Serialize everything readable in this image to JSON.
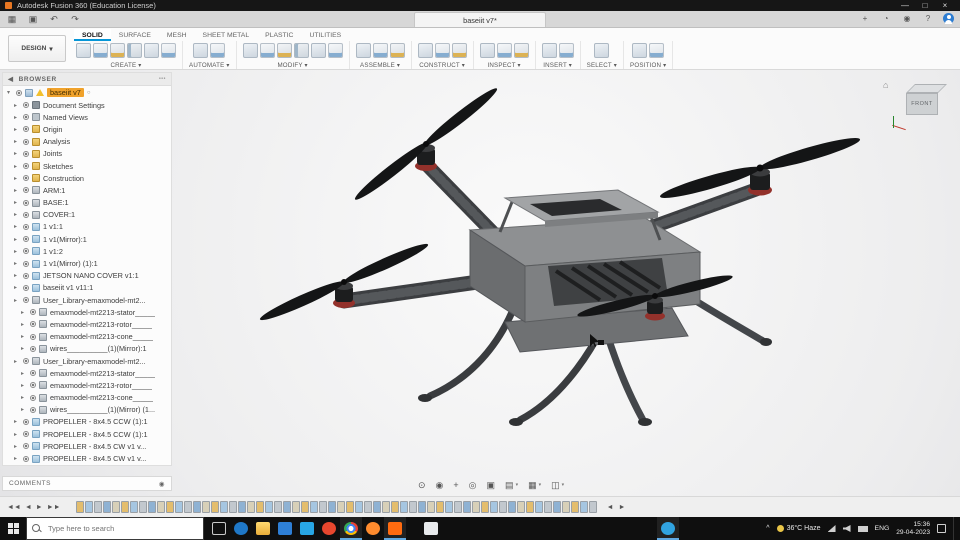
{
  "title_bar": {
    "title": "Autodesk Fusion 360 (Education License)"
  },
  "glyphs": {
    "menu": "▦",
    "save": "▣",
    "undo": "↶",
    "redo": "↷",
    "minimize": "—",
    "maximize": "□",
    "close": "×",
    "extensions": "+",
    "job_status": "◔",
    "notifications": "◉",
    "help": "?",
    "collapse": "◀",
    "options": "•••",
    "expand_item": "▸",
    "root_expand": "▾",
    "design_caret": "▾",
    "tray_expand": "^",
    "home": "⌂",
    "sync": "○",
    "comments_icon": "◉"
  },
  "quick_access": {
    "doc_tab": "baseiit v7*"
  },
  "toolbar": {
    "design_label": "DESIGN",
    "tabs": [
      {
        "label": "SOLID",
        "active": true
      },
      {
        "label": "SURFACE"
      },
      {
        "label": "MESH"
      },
      {
        "label": "SHEET METAL"
      },
      {
        "label": "PLASTIC"
      },
      {
        "label": "UTILITIES"
      }
    ],
    "groups": [
      {
        "label": "CREATE",
        "icons": 6
      },
      {
        "label": "AUTOMATE",
        "icons": 2
      },
      {
        "label": "MODIFY",
        "icons": 6
      },
      {
        "label": "ASSEMBLE",
        "icons": 3
      },
      {
        "label": "CONSTRUCT",
        "icons": 3
      },
      {
        "label": "INSPECT",
        "icons": 3
      },
      {
        "label": "INSERT",
        "icons": 2
      },
      {
        "label": "SELECT",
        "icons": 1
      },
      {
        "label": "POSITION",
        "icons": 2
      }
    ]
  },
  "browser": {
    "header": "BROWSER",
    "root": "baseiit v7",
    "items": [
      {
        "label": "Document Settings",
        "type": "settings",
        "indent": 1
      },
      {
        "label": "Named Views",
        "type": "views",
        "indent": 1
      },
      {
        "label": "Origin",
        "type": "folder",
        "indent": 1
      },
      {
        "label": "Analysis",
        "type": "folder",
        "indent": 1
      },
      {
        "label": "Joints",
        "type": "folder",
        "indent": 1
      },
      {
        "label": "Sketches",
        "type": "folder",
        "indent": 1
      },
      {
        "label": "Construction",
        "type": "folder",
        "indent": 1
      },
      {
        "label": "ARM:1",
        "type": "component",
        "indent": 1
      },
      {
        "label": "BASE:1",
        "type": "component",
        "indent": 1
      },
      {
        "label": "COVER:1",
        "type": "component",
        "indent": 1
      },
      {
        "label": "1 v1:1",
        "type": "link",
        "indent": 1
      },
      {
        "label": "1 v1(Mirror):1",
        "type": "link",
        "indent": 1
      },
      {
        "label": "1 v1:2",
        "type": "link",
        "indent": 1
      },
      {
        "label": "1 v1(Mirror) (1):1",
        "type": "link",
        "indent": 1
      },
      {
        "label": "JETSON NANO COVER v1:1",
        "type": "link",
        "indent": 1
      },
      {
        "label": "baseiit v1 v11:1",
        "type": "link",
        "indent": 1
      },
      {
        "label": "User_Library-emaxmodel-mt2...",
        "type": "component",
        "indent": 1
      },
      {
        "label": "emaxmodel-mt2213-stator_____",
        "type": "component",
        "indent": 2
      },
      {
        "label": "emaxmodel-mt2213-rotor_____",
        "type": "component",
        "indent": 2
      },
      {
        "label": "emaxmodel-mt2213-cone_____",
        "type": "component",
        "indent": 2
      },
      {
        "label": "wires__________(1)(Mirror):1",
        "type": "component",
        "indent": 2
      },
      {
        "label": "User_Library-emaxmodel-mt2...",
        "type": "component",
        "indent": 1
      },
      {
        "label": "emaxmodel-mt2213-stator_____",
        "type": "component",
        "indent": 2
      },
      {
        "label": "emaxmodel-mt2213-rotor_____",
        "type": "component",
        "indent": 2
      },
      {
        "label": "emaxmodel-mt2213-cone_____",
        "type": "component",
        "indent": 2
      },
      {
        "label": "wires__________(1)(Mirror) (1...",
        "type": "component",
        "indent": 2
      },
      {
        "label": "PROPELLER - 8x4.5 CCW (1):1",
        "type": "link",
        "indent": 1
      },
      {
        "label": "PROPELLER - 8x4.5 CCW (1):1",
        "type": "link",
        "indent": 1
      },
      {
        "label": "PROPELLER - 8x4.5 CW v1 v...",
        "type": "link",
        "indent": 1
      },
      {
        "label": "PROPELLER - 8x4.5 CW v1 v...",
        "type": "link",
        "indent": 1
      }
    ]
  },
  "view_cube": {
    "face": "FRONT"
  },
  "comments": {
    "header": "COMMENTS"
  },
  "nav_bar": {
    "tools": [
      {
        "name": "orbit",
        "glyph": "⊙"
      },
      {
        "name": "look-at",
        "glyph": "◉"
      },
      {
        "name": "pan",
        "glyph": "+"
      },
      {
        "name": "zoom",
        "glyph": "◎"
      },
      {
        "name": "fit",
        "glyph": "▣"
      },
      {
        "name": "display-settings",
        "glyph": "▤",
        "caret": true
      },
      {
        "name": "grid-and-snaps",
        "glyph": "▦",
        "caret": true
      },
      {
        "name": "viewports",
        "glyph": "◫",
        "caret": true
      }
    ]
  },
  "timeline": {
    "controls": [
      {
        "name": "jump-to-begin",
        "glyph": "◄◄"
      },
      {
        "name": "step-back",
        "glyph": "◄"
      },
      {
        "name": "play",
        "glyph": "►"
      },
      {
        "name": "jump-to-end",
        "glyph": "►►"
      }
    ],
    "operation_count": 58,
    "nav": [
      {
        "name": "scroll-left",
        "glyph": "◄"
      },
      {
        "name": "scroll-right",
        "glyph": "►"
      }
    ]
  },
  "taskbar": {
    "search_placeholder": "Type here to search",
    "apps": [
      {
        "name": "task-view",
        "shape": "taskview",
        "color": "#cccccc"
      },
      {
        "name": "edge",
        "shape": "circle",
        "color": "#1f78c8"
      },
      {
        "name": "file-explorer",
        "shape": "folder",
        "color": "#f3c14b"
      },
      {
        "name": "store",
        "shape": "square",
        "color": "#2e7fd6"
      },
      {
        "name": "vs-code",
        "shape": "square",
        "color": "#28a6e4"
      },
      {
        "name": "brave",
        "shape": "circle",
        "color": "#e8472e"
      },
      {
        "name": "chrome",
        "shape": "chrome",
        "color": "#4285f4",
        "active": true
      },
      {
        "name": "firefox",
        "shape": "circle",
        "color": "#ff8b2e"
      },
      {
        "name": "fusion-360",
        "shape": "square",
        "color": "#ff6b10",
        "active": true
      },
      {
        "name": "notepad",
        "shape": "square",
        "color": "#e8eaec",
        "gap": 14
      },
      {
        "name": "skype",
        "shape": "circle",
        "color": "#31a3e0",
        "gap": 215,
        "active": true
      }
    ],
    "tray": {
      "weather": "36°C Haze",
      "language": "ENG",
      "time": "15:36",
      "date": "29-04-2023"
    }
  }
}
